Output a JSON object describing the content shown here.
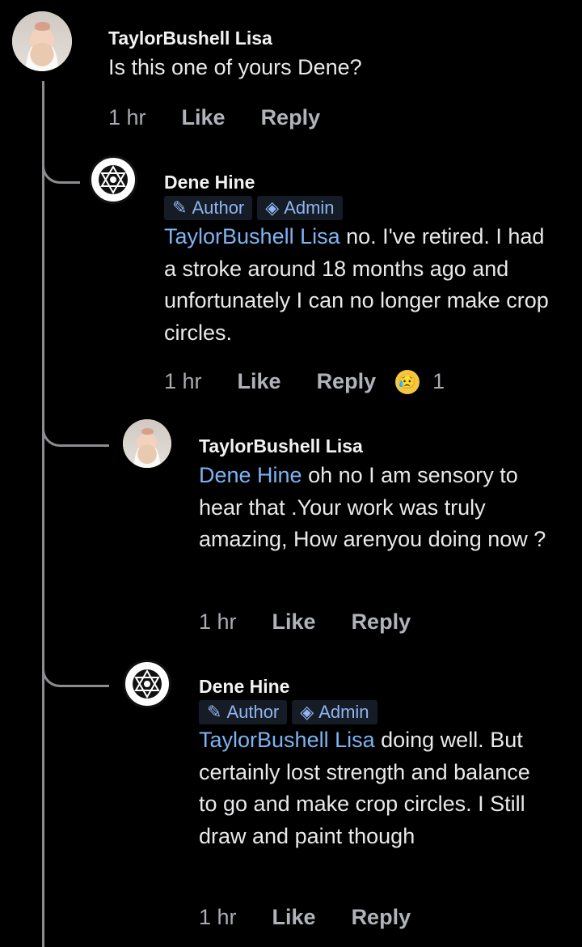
{
  "comments": [
    {
      "author": "TaylorBushell Lisa",
      "mention": "",
      "text": "Is this one of yours Dene?",
      "time": "1 hr",
      "like": "Like",
      "reply": "Reply",
      "avatar_icon": "baby-photo-avatar"
    },
    {
      "author": "Dene Hine",
      "badges": [
        "Author",
        "Admin"
      ],
      "mention": "TaylorBushell Lisa",
      "text": " no. I've retired.  I had a stroke around 18 months ago and unfortunately I can no longer make crop circles.",
      "time": "1 hr",
      "like": "Like",
      "reply": "Reply",
      "reaction_icon": "sad-tear-emoji",
      "reaction_count": "1",
      "avatar_icon": "star-emblem-avatar"
    },
    {
      "author": "TaylorBushell Lisa",
      "mention": "Dene Hine",
      "text": " oh no I am sensory to hear that .Your work was truly amazing, How arenyou doing now ?",
      "time": "1 hr",
      "like": "Like",
      "reply": "Reply",
      "avatar_icon": "baby-photo-avatar"
    },
    {
      "author": "Dene Hine",
      "badges": [
        "Author",
        "Admin"
      ],
      "mention": "TaylorBushell Lisa",
      "text": " doing well. But certainly lost strength and balance to go and make crop circles. I Still draw and paint though",
      "time": "1 hr",
      "like": "Like",
      "reply": "Reply",
      "avatar_icon": "star-emblem-avatar"
    }
  ],
  "colors": {
    "background": "#000000",
    "mention": "#7cb4f3",
    "badge_bg": "#161c26",
    "badge_text": "#8fb4f0",
    "meta": "#a8abb2"
  }
}
